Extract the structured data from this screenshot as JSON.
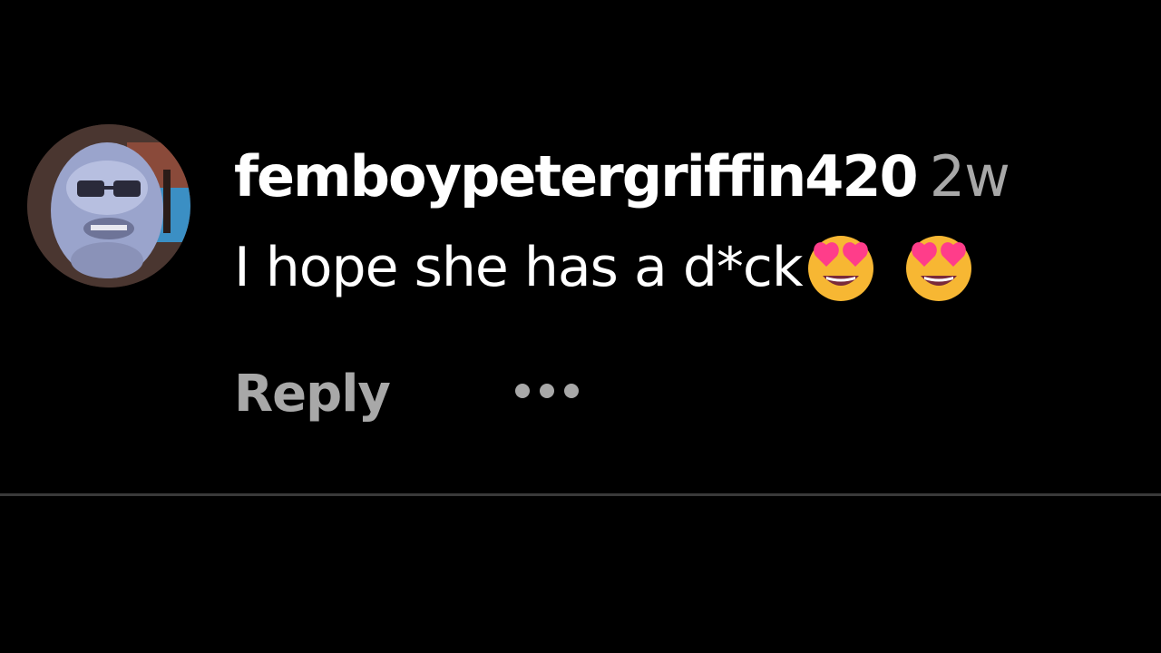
{
  "comment": {
    "username": "femboypetergriffin420",
    "timestamp": "2w",
    "text": "I hope she has a d*ck",
    "emojis": [
      "smiling-face-with-heart-eyes-icon",
      "smiling-face-with-heart-eyes-icon"
    ]
  },
  "actions": {
    "reply_label": "Reply",
    "more_icon": "more-options-icon"
  },
  "colors": {
    "background": "#000000",
    "username": "#ffffff",
    "timestamp": "#a8a8a8",
    "text": "#ffffff",
    "reply": "#a8a8a8",
    "divider": "#3a3a3a"
  }
}
